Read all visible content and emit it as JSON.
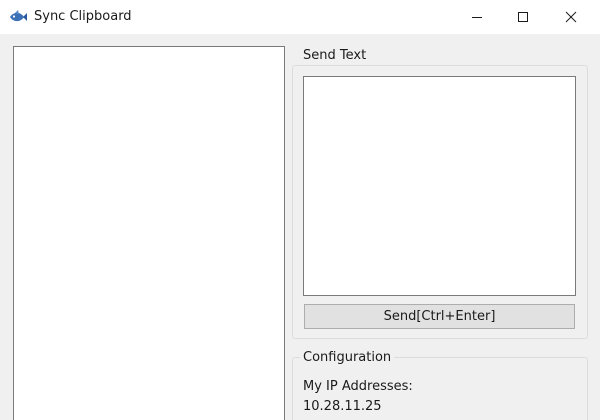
{
  "window": {
    "title": "Sync Clipboard",
    "icon": "fish-icon",
    "controls": [
      "minimize-icon",
      "maximize-icon",
      "close-icon"
    ]
  },
  "left_pane": {
    "items": []
  },
  "send_text": {
    "group_label": "Send Text",
    "input_value": "",
    "button_label": "Send[Ctrl+Enter]"
  },
  "configuration": {
    "group_label": "Configuration",
    "ip_label": "My IP Addresses:",
    "ip_value": "10.28.11.25"
  },
  "colors": {
    "fish_icon": "#3b6fb6",
    "window_bg": "#f0f0f0",
    "titlebar_bg": "#ffffff",
    "button_bg": "#e1e1e1"
  }
}
